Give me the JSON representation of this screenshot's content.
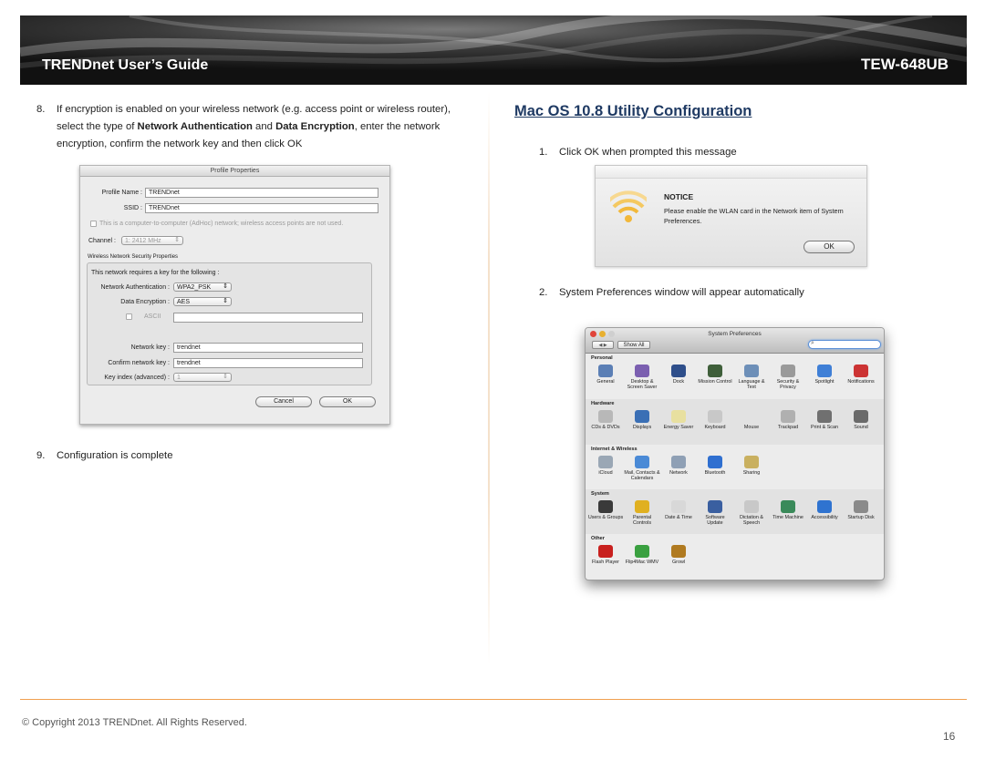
{
  "header": {
    "title": "TRENDnet User’s Guide",
    "model": "TEW-648UB"
  },
  "left": {
    "step8": {
      "num": "8.",
      "text_a": "If encryption is enabled on your wireless network (e.g. access point or wireless router), select the type of ",
      "bold1": "Network Authentication",
      "text_b": " and ",
      "bold2": "Data Encryption",
      "text_c": ", enter the network encryption, confirm the network key and then click OK"
    },
    "profile_dialog": {
      "title": "Profile Properties",
      "profile_name_label": "Profile Name :",
      "profile_name_value": "TRENDnet",
      "ssid_label": "SSID :",
      "ssid_value": "TRENDnet",
      "adhoc_label": "This is a computer-to-computer (AdHoc) network; wireless access points are not used.",
      "channel_label": "Channel :",
      "channel_value": "1: 2412 MHz",
      "security_group_label": "Wireless Network Security Properties",
      "requires_key_label": "This network requires a key for the following :",
      "auth_label": "Network Authentication :",
      "auth_value": "WPA2_PSK",
      "enc_label": "Data Encryption :",
      "enc_value": "AES",
      "ascii_label": "ASCII",
      "network_key_label": "Network key :",
      "network_key_value": "trendnet",
      "confirm_key_label": "Confirm network key :",
      "confirm_key_value": "trendnet",
      "key_index_label": "Key index (advanced) :",
      "key_index_value": "1",
      "cancel_label": "Cancel",
      "ok_label": "OK"
    },
    "step9": {
      "num": "9.",
      "text": "Configuration is complete"
    }
  },
  "right": {
    "section_title": "Mac OS 10.8 Utility Configuration",
    "step1": {
      "num": "1.",
      "text": "Click OK when prompted this message"
    },
    "notice_dialog": {
      "heading": "NOTICE",
      "message": "Please enable the WLAN card in the Network item of System Preferences.",
      "ok_label": "OK"
    },
    "step2": {
      "num": "2.",
      "text": "System Preferences window will appear automatically"
    },
    "system_preferences": {
      "window_title": "System Preferences",
      "nav_label": "◀ ▶",
      "show_all_label": "Show All",
      "sections": [
        {
          "title": "Personal",
          "items": [
            {
              "label": "General",
              "icon": "general-icon",
              "color": "#5b7fb5"
            },
            {
              "label": "Desktop & Screen Saver",
              "icon": "desktop-icon",
              "color": "#7b5fb0"
            },
            {
              "label": "Dock",
              "icon": "dock-icon",
              "color": "#2e4e8a"
            },
            {
              "label": "Mission Control",
              "icon": "mission-control-icon",
              "color": "#3f5f3a"
            },
            {
              "label": "Language & Text",
              "icon": "language-icon",
              "color": "#6d8fb8"
            },
            {
              "label": "Security & Privacy",
              "icon": "security-icon",
              "color": "#9a9a9a"
            },
            {
              "label": "Spotlight",
              "icon": "spotlight-icon",
              "color": "#3f7fd6"
            },
            {
              "label": "Notifications",
              "icon": "notifications-icon",
              "color": "#c33"
            }
          ]
        },
        {
          "title": "Hardware",
          "items": [
            {
              "label": "CDs & DVDs",
              "icon": "cd-icon",
              "color": "#b8b8b8"
            },
            {
              "label": "Displays",
              "icon": "displays-icon",
              "color": "#3a6fb5"
            },
            {
              "label": "Energy Saver",
              "icon": "energy-icon",
              "color": "#e8e0a0"
            },
            {
              "label": "Keyboard",
              "icon": "keyboard-icon",
              "color": "#c8c8c8"
            },
            {
              "label": "Mouse",
              "icon": "mouse-icon",
              "color": "#e2e2e2"
            },
            {
              "label": "Trackpad",
              "icon": "trackpad-icon",
              "color": "#b0b0b0"
            },
            {
              "label": "Print & Scan",
              "icon": "printer-icon",
              "color": "#707070"
            },
            {
              "label": "Sound",
              "icon": "sound-icon",
              "color": "#6a6a6a"
            }
          ]
        },
        {
          "title": "Internet & Wireless",
          "items": [
            {
              "label": "iCloud",
              "icon": "icloud-icon",
              "color": "#9aa7b5"
            },
            {
              "label": "Mail, Contacts & Calendars",
              "icon": "mail-icon",
              "color": "#4a8ad6"
            },
            {
              "label": "Network",
              "icon": "network-icon",
              "color": "#8fa0b5"
            },
            {
              "label": "Bluetooth",
              "icon": "bluetooth-icon",
              "color": "#2f6fd0"
            },
            {
              "label": "Sharing",
              "icon": "sharing-icon",
              "color": "#c9b060"
            }
          ]
        },
        {
          "title": "System",
          "items": [
            {
              "label": "Users & Groups",
              "icon": "users-icon",
              "color": "#3a3a3a"
            },
            {
              "label": "Parental Controls",
              "icon": "parental-icon",
              "color": "#e0b020"
            },
            {
              "label": "Date & Time",
              "icon": "clock-icon",
              "color": "#d8d8d8"
            },
            {
              "label": "Software Update",
              "icon": "update-icon",
              "color": "#3a5fa0"
            },
            {
              "label": "Dictation & Speech",
              "icon": "dictation-icon",
              "color": "#c8c8c8"
            },
            {
              "label": "Time Machine",
              "icon": "time-machine-icon",
              "color": "#3a8a5a"
            },
            {
              "label": "Accessibility",
              "icon": "accessibility-icon",
              "color": "#2f73d0"
            },
            {
              "label": "Startup Disk",
              "icon": "startup-disk-icon",
              "color": "#8a8a8a"
            }
          ]
        },
        {
          "title": "Other",
          "items": [
            {
              "label": "Flash Player",
              "icon": "flash-icon",
              "color": "#c8201e"
            },
            {
              "label": "Flip4Mac WMV",
              "icon": "flip4mac-icon",
              "color": "#3aa040"
            },
            {
              "label": "Growl",
              "icon": "growl-icon",
              "color": "#b07a20"
            }
          ]
        }
      ]
    }
  },
  "footer": {
    "copyright": "© Copyright 2013 TRENDnet. All Rights Reserved.",
    "page_number": "16"
  }
}
